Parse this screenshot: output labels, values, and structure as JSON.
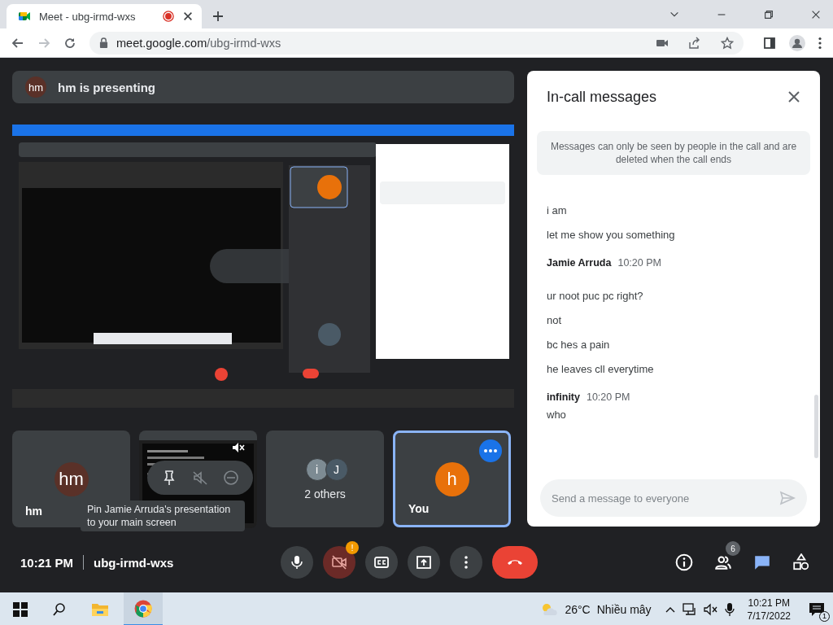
{
  "browser": {
    "tab_title": "Meet - ubg-irmd-wxs",
    "url_host": "meet.google.com",
    "url_path": "/ubg-irmd-wxs"
  },
  "presenting_banner": {
    "initials": "hm",
    "text": "hm is presenting"
  },
  "tiles": [
    {
      "kind": "person",
      "initials": "hm",
      "name": "hm",
      "color": "#5a3128",
      "selected": false
    },
    {
      "kind": "screen",
      "tooltip": "Pin Jamie Arruda's presentation to your main screen",
      "selected": false
    },
    {
      "kind": "group",
      "avatars": [
        {
          "initials": "i",
          "color": "#7d8b93"
        },
        {
          "initials": "J",
          "color": "#4a5a66"
        }
      ],
      "label": "2 others",
      "selected": false
    },
    {
      "kind": "person",
      "initials": "h",
      "name": "You",
      "color": "#e8710a",
      "selected": true
    }
  ],
  "chat": {
    "title": "In-call messages",
    "notice": "Messages can only be seen by people in the call and are deleted when the call ends",
    "groups": [
      {
        "lines": [
          "i am",
          "let me show you something"
        ]
      },
      {
        "sender": "Jamie Arruda",
        "time": "10:20 PM",
        "lines": [
          "ur noot puc pc right?",
          "not",
          "bc hes a pain",
          "he leaves cll everytime"
        ]
      },
      {
        "sender": "infinity",
        "time": "10:20 PM",
        "lines": [
          "who"
        ]
      }
    ],
    "placeholder": "Send a message to everyone"
  },
  "call_bar": {
    "time": "10:21 PM",
    "meeting_code": "ubg-irmd-wxs",
    "controls": [
      {
        "kind": "mic",
        "on": true
      },
      {
        "kind": "camera",
        "on": false,
        "alert": "!"
      },
      {
        "kind": "captions"
      },
      {
        "kind": "present"
      },
      {
        "kind": "more"
      },
      {
        "kind": "end"
      }
    ],
    "side_buttons": [
      {
        "kind": "info",
        "selected": false
      },
      {
        "kind": "people",
        "badge": "6",
        "selected": false
      },
      {
        "kind": "chat",
        "selected": true
      },
      {
        "kind": "activities",
        "selected": false
      }
    ]
  },
  "taskbar": {
    "temperature": "26°C",
    "weather": "Nhiều mây",
    "time": "10:21 PM",
    "date": "7/17/2022",
    "notifications": "1"
  }
}
